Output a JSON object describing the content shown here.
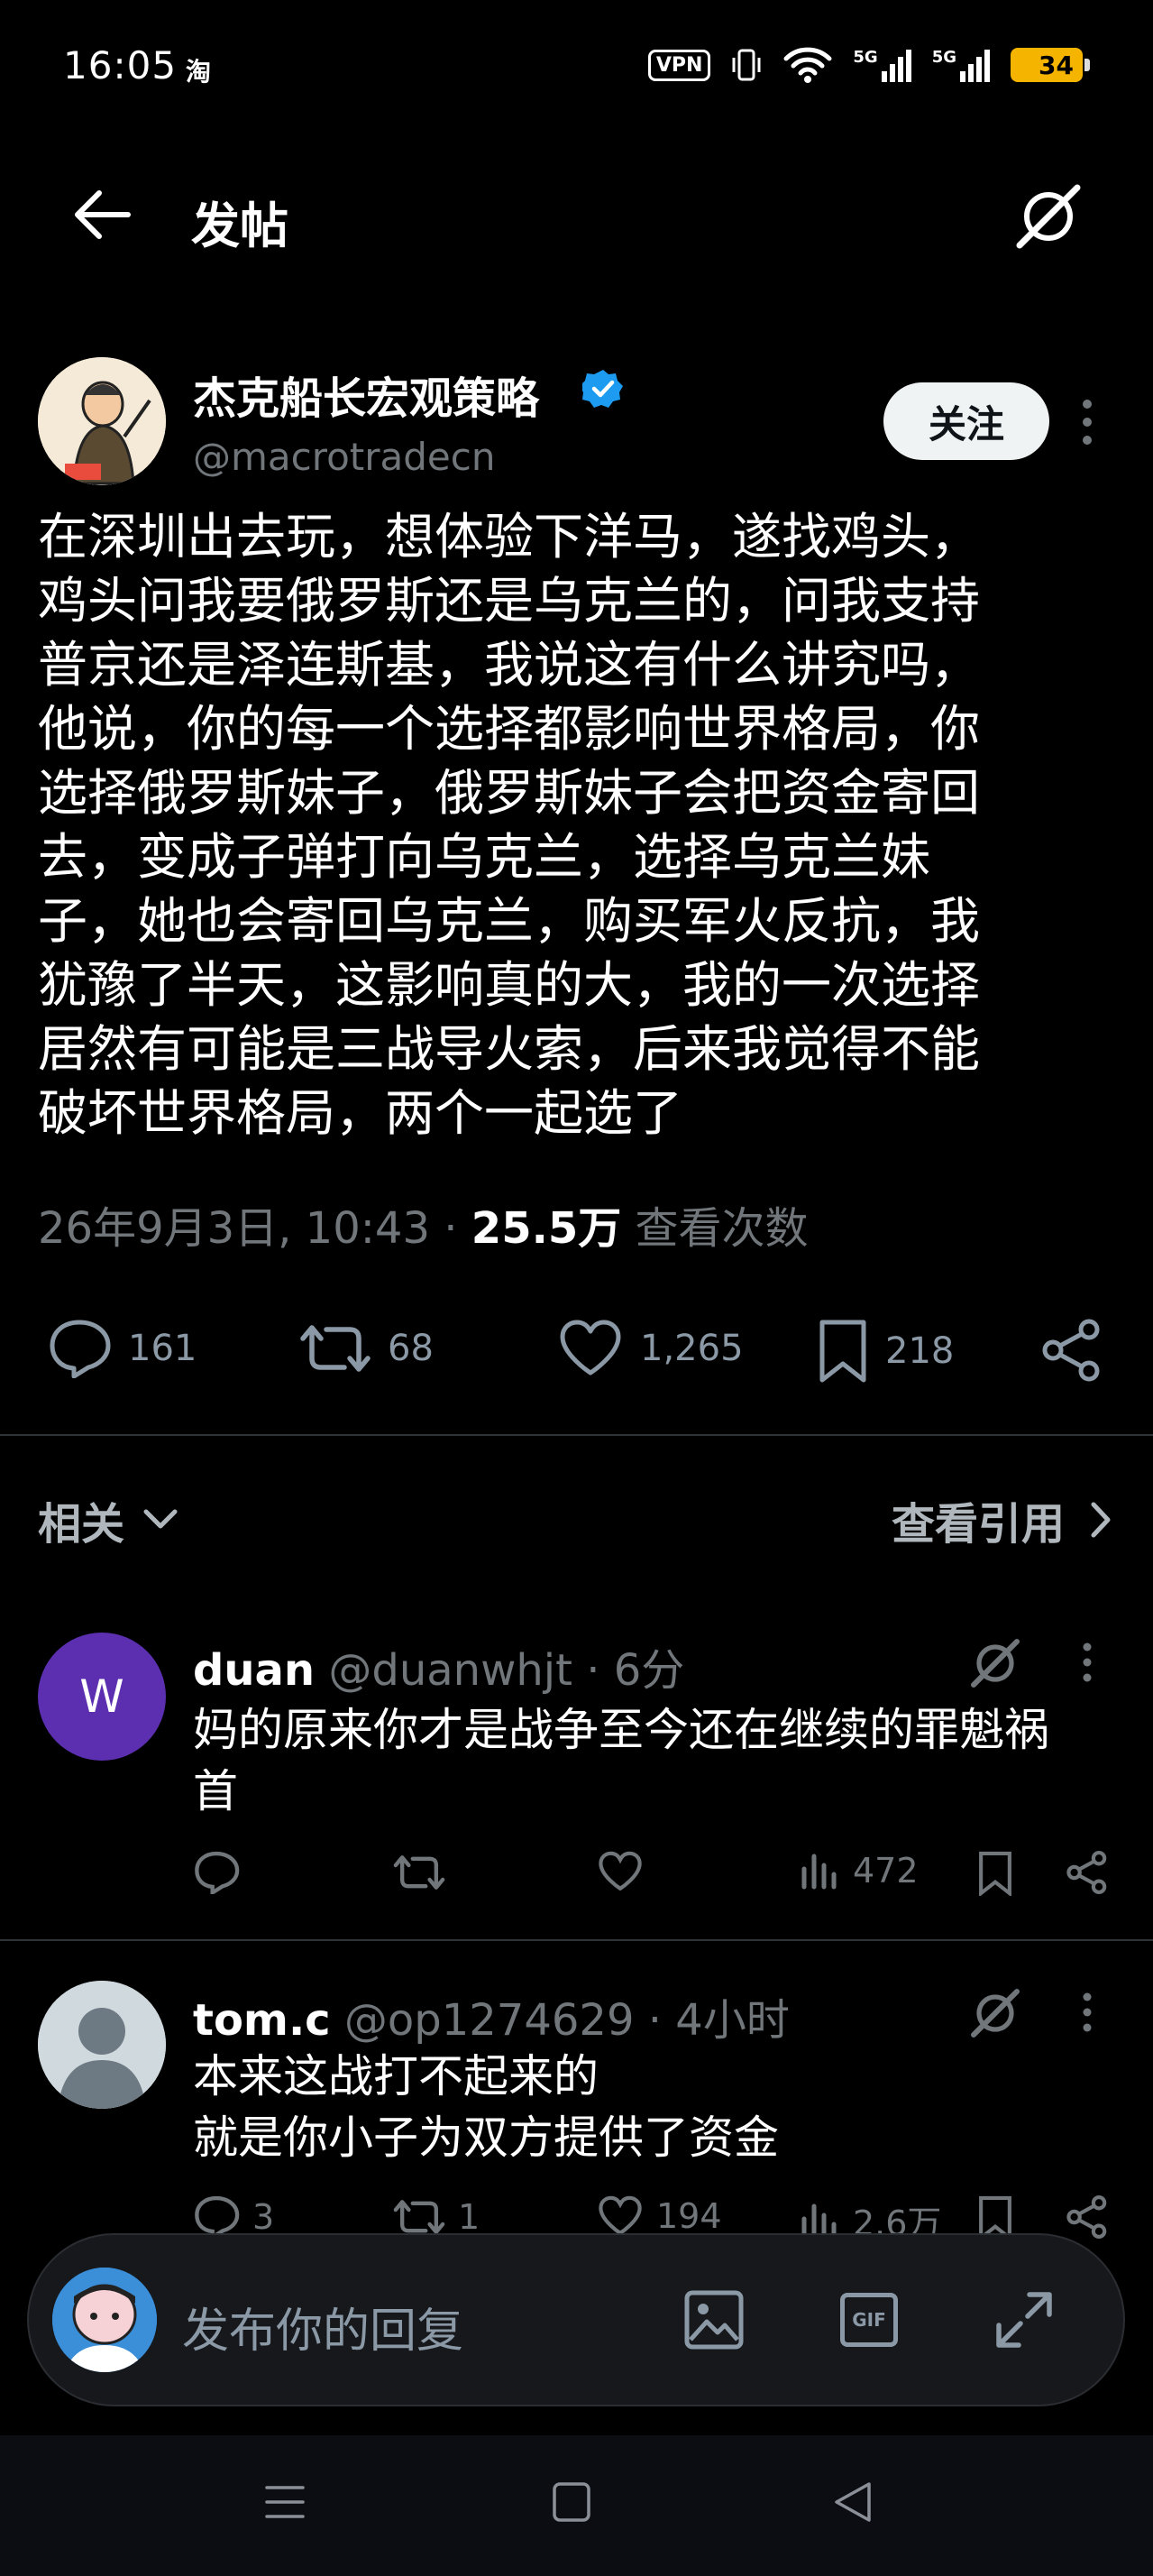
{
  "status_bar": {
    "time": "16:05",
    "app_indicator": "淘",
    "vpn_label": "VPN",
    "net1": "5G",
    "net2": "5G",
    "battery": "34"
  },
  "header": {
    "title": "发帖",
    "back_icon": "arrow-left-icon",
    "grok_icon": "grok-icon"
  },
  "post": {
    "author_name": "杰克船长宏观策略",
    "author_handle": "@macrotradecn",
    "follow_label": "关注",
    "body": "在深圳出去玩，想体验下洋马，遂找鸡头，\n鸡头问我要俄罗斯还是乌克兰的，问我支持\n普京还是泽连斯基，我说这有什么讲究吗，\n他说，你的每一个选择都影响世界格局，你\n选择俄罗斯妹子，俄罗斯妹子会把资金寄回\n去，变成子弹打向乌克兰，选择乌克兰妹\n子，她也会寄回乌克兰，购买军火反抗，我\n犹豫了半天，这影响真的大，我的一次选择\n居然有可能是三战导火索，后来我觉得不能\n破坏世界格局，两个一起选了",
    "timestamp": "26年9月3日, 10:43",
    "views_count": "25.5万",
    "views_label": "查看次数",
    "replies": "161",
    "reposts": "68",
    "likes": "1,265",
    "bookmarks": "218"
  },
  "related": {
    "label": "相关",
    "quotes_label": "查看引用"
  },
  "replies": [
    {
      "avatar_letter": "W",
      "avatar_color": "#5b2fb0",
      "name": "duan",
      "handle": "@duanwhjt",
      "time": "· 6分",
      "text": "妈的原来你才是战争至今还在继续的罪魁祸\n首",
      "replies": "",
      "reposts": "",
      "likes": "",
      "views": "472"
    },
    {
      "name": "tom.c",
      "handle": "@op1274629",
      "time": "· 4小时",
      "text": "本来这战打不起来的\n就是你小子为双方提供了资金",
      "replies": "3",
      "reposts": "1",
      "likes": "194",
      "views": "2.6万"
    }
  ],
  "compose": {
    "placeholder": "发布你的回复",
    "gif_label": "GIF"
  },
  "colors": {
    "background": "#000000",
    "text": "#e7e9ea",
    "muted": "#71767b",
    "verified": "#1d9bf0",
    "battery": "#f5b400"
  }
}
